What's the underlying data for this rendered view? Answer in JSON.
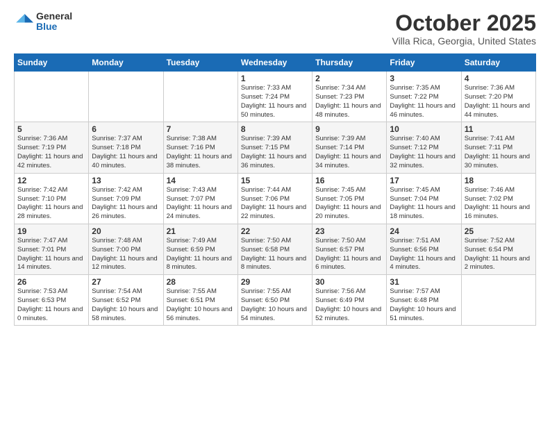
{
  "header": {
    "logo_general": "General",
    "logo_blue": "Blue",
    "month": "October 2025",
    "location": "Villa Rica, Georgia, United States"
  },
  "weekdays": [
    "Sunday",
    "Monday",
    "Tuesday",
    "Wednesday",
    "Thursday",
    "Friday",
    "Saturday"
  ],
  "weeks": [
    [
      {
        "day": "",
        "sunrise": "",
        "sunset": "",
        "daylight": ""
      },
      {
        "day": "",
        "sunrise": "",
        "sunset": "",
        "daylight": ""
      },
      {
        "day": "",
        "sunrise": "",
        "sunset": "",
        "daylight": ""
      },
      {
        "day": "1",
        "sunrise": "Sunrise: 7:33 AM",
        "sunset": "Sunset: 7:24 PM",
        "daylight": "Daylight: 11 hours and 50 minutes."
      },
      {
        "day": "2",
        "sunrise": "Sunrise: 7:34 AM",
        "sunset": "Sunset: 7:23 PM",
        "daylight": "Daylight: 11 hours and 48 minutes."
      },
      {
        "day": "3",
        "sunrise": "Sunrise: 7:35 AM",
        "sunset": "Sunset: 7:22 PM",
        "daylight": "Daylight: 11 hours and 46 minutes."
      },
      {
        "day": "4",
        "sunrise": "Sunrise: 7:36 AM",
        "sunset": "Sunset: 7:20 PM",
        "daylight": "Daylight: 11 hours and 44 minutes."
      }
    ],
    [
      {
        "day": "5",
        "sunrise": "Sunrise: 7:36 AM",
        "sunset": "Sunset: 7:19 PM",
        "daylight": "Daylight: 11 hours and 42 minutes."
      },
      {
        "day": "6",
        "sunrise": "Sunrise: 7:37 AM",
        "sunset": "Sunset: 7:18 PM",
        "daylight": "Daylight: 11 hours and 40 minutes."
      },
      {
        "day": "7",
        "sunrise": "Sunrise: 7:38 AM",
        "sunset": "Sunset: 7:16 PM",
        "daylight": "Daylight: 11 hours and 38 minutes."
      },
      {
        "day": "8",
        "sunrise": "Sunrise: 7:39 AM",
        "sunset": "Sunset: 7:15 PM",
        "daylight": "Daylight: 11 hours and 36 minutes."
      },
      {
        "day": "9",
        "sunrise": "Sunrise: 7:39 AM",
        "sunset": "Sunset: 7:14 PM",
        "daylight": "Daylight: 11 hours and 34 minutes."
      },
      {
        "day": "10",
        "sunrise": "Sunrise: 7:40 AM",
        "sunset": "Sunset: 7:12 PM",
        "daylight": "Daylight: 11 hours and 32 minutes."
      },
      {
        "day": "11",
        "sunrise": "Sunrise: 7:41 AM",
        "sunset": "Sunset: 7:11 PM",
        "daylight": "Daylight: 11 hours and 30 minutes."
      }
    ],
    [
      {
        "day": "12",
        "sunrise": "Sunrise: 7:42 AM",
        "sunset": "Sunset: 7:10 PM",
        "daylight": "Daylight: 11 hours and 28 minutes."
      },
      {
        "day": "13",
        "sunrise": "Sunrise: 7:42 AM",
        "sunset": "Sunset: 7:09 PM",
        "daylight": "Daylight: 11 hours and 26 minutes."
      },
      {
        "day": "14",
        "sunrise": "Sunrise: 7:43 AM",
        "sunset": "Sunset: 7:07 PM",
        "daylight": "Daylight: 11 hours and 24 minutes."
      },
      {
        "day": "15",
        "sunrise": "Sunrise: 7:44 AM",
        "sunset": "Sunset: 7:06 PM",
        "daylight": "Daylight: 11 hours and 22 minutes."
      },
      {
        "day": "16",
        "sunrise": "Sunrise: 7:45 AM",
        "sunset": "Sunset: 7:05 PM",
        "daylight": "Daylight: 11 hours and 20 minutes."
      },
      {
        "day": "17",
        "sunrise": "Sunrise: 7:45 AM",
        "sunset": "Sunset: 7:04 PM",
        "daylight": "Daylight: 11 hours and 18 minutes."
      },
      {
        "day": "18",
        "sunrise": "Sunrise: 7:46 AM",
        "sunset": "Sunset: 7:02 PM",
        "daylight": "Daylight: 11 hours and 16 minutes."
      }
    ],
    [
      {
        "day": "19",
        "sunrise": "Sunrise: 7:47 AM",
        "sunset": "Sunset: 7:01 PM",
        "daylight": "Daylight: 11 hours and 14 minutes."
      },
      {
        "day": "20",
        "sunrise": "Sunrise: 7:48 AM",
        "sunset": "Sunset: 7:00 PM",
        "daylight": "Daylight: 11 hours and 12 minutes."
      },
      {
        "day": "21",
        "sunrise": "Sunrise: 7:49 AM",
        "sunset": "Sunset: 6:59 PM",
        "daylight": "Daylight: 11 hours and 8 minutes."
      },
      {
        "day": "22",
        "sunrise": "Sunrise: 7:50 AM",
        "sunset": "Sunset: 6:58 PM",
        "daylight": "Daylight: 11 hours and 8 minutes."
      },
      {
        "day": "23",
        "sunrise": "Sunrise: 7:50 AM",
        "sunset": "Sunset: 6:57 PM",
        "daylight": "Daylight: 11 hours and 6 minutes."
      },
      {
        "day": "24",
        "sunrise": "Sunrise: 7:51 AM",
        "sunset": "Sunset: 6:56 PM",
        "daylight": "Daylight: 11 hours and 4 minutes."
      },
      {
        "day": "25",
        "sunrise": "Sunrise: 7:52 AM",
        "sunset": "Sunset: 6:54 PM",
        "daylight": "Daylight: 11 hours and 2 minutes."
      }
    ],
    [
      {
        "day": "26",
        "sunrise": "Sunrise: 7:53 AM",
        "sunset": "Sunset: 6:53 PM",
        "daylight": "Daylight: 11 hours and 0 minutes."
      },
      {
        "day": "27",
        "sunrise": "Sunrise: 7:54 AM",
        "sunset": "Sunset: 6:52 PM",
        "daylight": "Daylight: 10 hours and 58 minutes."
      },
      {
        "day": "28",
        "sunrise": "Sunrise: 7:55 AM",
        "sunset": "Sunset: 6:51 PM",
        "daylight": "Daylight: 10 hours and 56 minutes."
      },
      {
        "day": "29",
        "sunrise": "Sunrise: 7:55 AM",
        "sunset": "Sunset: 6:50 PM",
        "daylight": "Daylight: 10 hours and 54 minutes."
      },
      {
        "day": "30",
        "sunrise": "Sunrise: 7:56 AM",
        "sunset": "Sunset: 6:49 PM",
        "daylight": "Daylight: 10 hours and 52 minutes."
      },
      {
        "day": "31",
        "sunrise": "Sunrise: 7:57 AM",
        "sunset": "Sunset: 6:48 PM",
        "daylight": "Daylight: 10 hours and 51 minutes."
      },
      {
        "day": "",
        "sunrise": "",
        "sunset": "",
        "daylight": ""
      }
    ]
  ]
}
